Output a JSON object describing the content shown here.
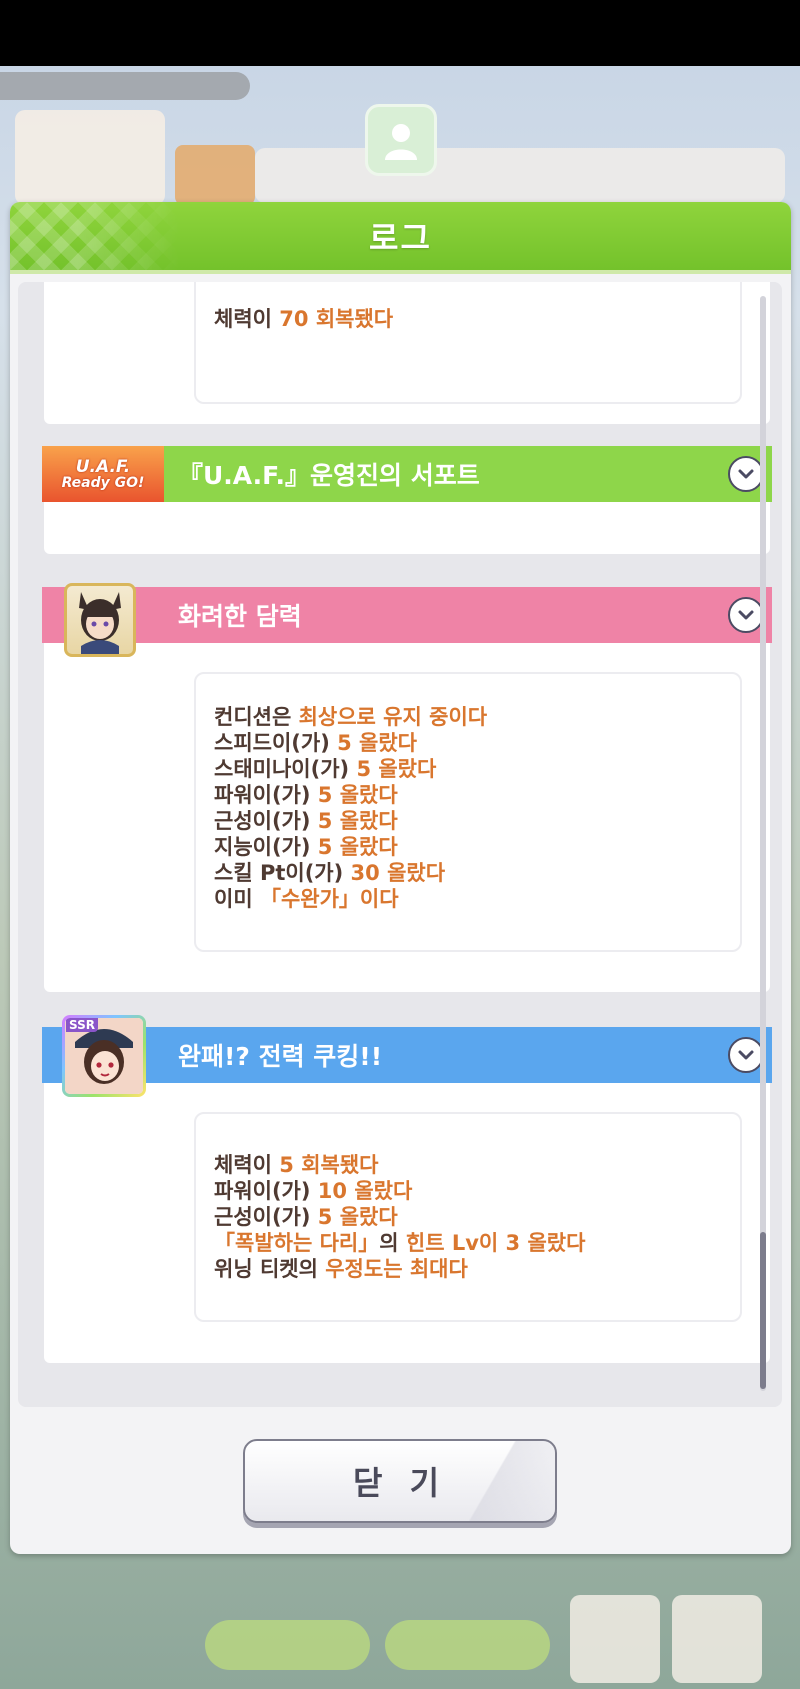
{
  "dialog": {
    "title": "로그",
    "close_label": "닫 기"
  },
  "entries": [
    {
      "header": "",
      "lines": [
        [
          {
            "t": "체력이 ",
            "hl": false
          },
          {
            "t": "70 회복됐다",
            "hl": true
          }
        ]
      ]
    },
    {
      "header": "『U.A.F.』운영진의 서포트",
      "header_color": "#8ed64a",
      "logo_text": [
        "U.A.F.",
        "Ready GO!"
      ],
      "lines": []
    },
    {
      "header": "화려한 담력",
      "header_color": "#ef83a6",
      "lines": [
        [
          {
            "t": "컨디션은 ",
            "hl": false
          },
          {
            "t": "최상으로 유지 중이다",
            "hl": true
          }
        ],
        [
          {
            "t": "스피드이(가) ",
            "hl": false
          },
          {
            "t": "5 올랐다",
            "hl": true
          }
        ],
        [
          {
            "t": "스태미나이(가) ",
            "hl": false
          },
          {
            "t": "5 올랐다",
            "hl": true
          }
        ],
        [
          {
            "t": "파워이(가) ",
            "hl": false
          },
          {
            "t": "5 올랐다",
            "hl": true
          }
        ],
        [
          {
            "t": "근성이(가) ",
            "hl": false
          },
          {
            "t": "5 올랐다",
            "hl": true
          }
        ],
        [
          {
            "t": "지능이(가) ",
            "hl": false
          },
          {
            "t": "5 올랐다",
            "hl": true
          }
        ],
        [
          {
            "t": "스킬 Pt이(가) ",
            "hl": false
          },
          {
            "t": "30 올랐다",
            "hl": true
          }
        ],
        [
          {
            "t": "이미 ",
            "hl": false
          },
          {
            "t": "「수완가」이다",
            "hl": true
          }
        ]
      ]
    },
    {
      "header": "완패!? 전력 쿠킹!!",
      "header_color": "#5aa6ee",
      "badge": "SSR",
      "lines": [
        [
          {
            "t": "체력이 ",
            "hl": false
          },
          {
            "t": "5 회복됐다",
            "hl": true
          }
        ],
        [
          {
            "t": "파워이(가) ",
            "hl": false
          },
          {
            "t": "10 올랐다",
            "hl": true
          }
        ],
        [
          {
            "t": "근성이(가) ",
            "hl": false
          },
          {
            "t": "5 올랐다",
            "hl": true
          }
        ],
        [
          {
            "t": "「폭발하는 다리」",
            "hl": true
          },
          {
            "t": "의 ",
            "hl": false
          },
          {
            "t": "힌트 Lv이 3 올랐다",
            "hl": true
          }
        ],
        [
          {
            "t": "위닝 티켓의 ",
            "hl": false
          },
          {
            "t": "우정도는 최대다",
            "hl": true
          }
        ]
      ]
    }
  ],
  "icons": {
    "expand": "chevron-down-icon",
    "placeholder_avatar": "person-placeholder-icon"
  }
}
